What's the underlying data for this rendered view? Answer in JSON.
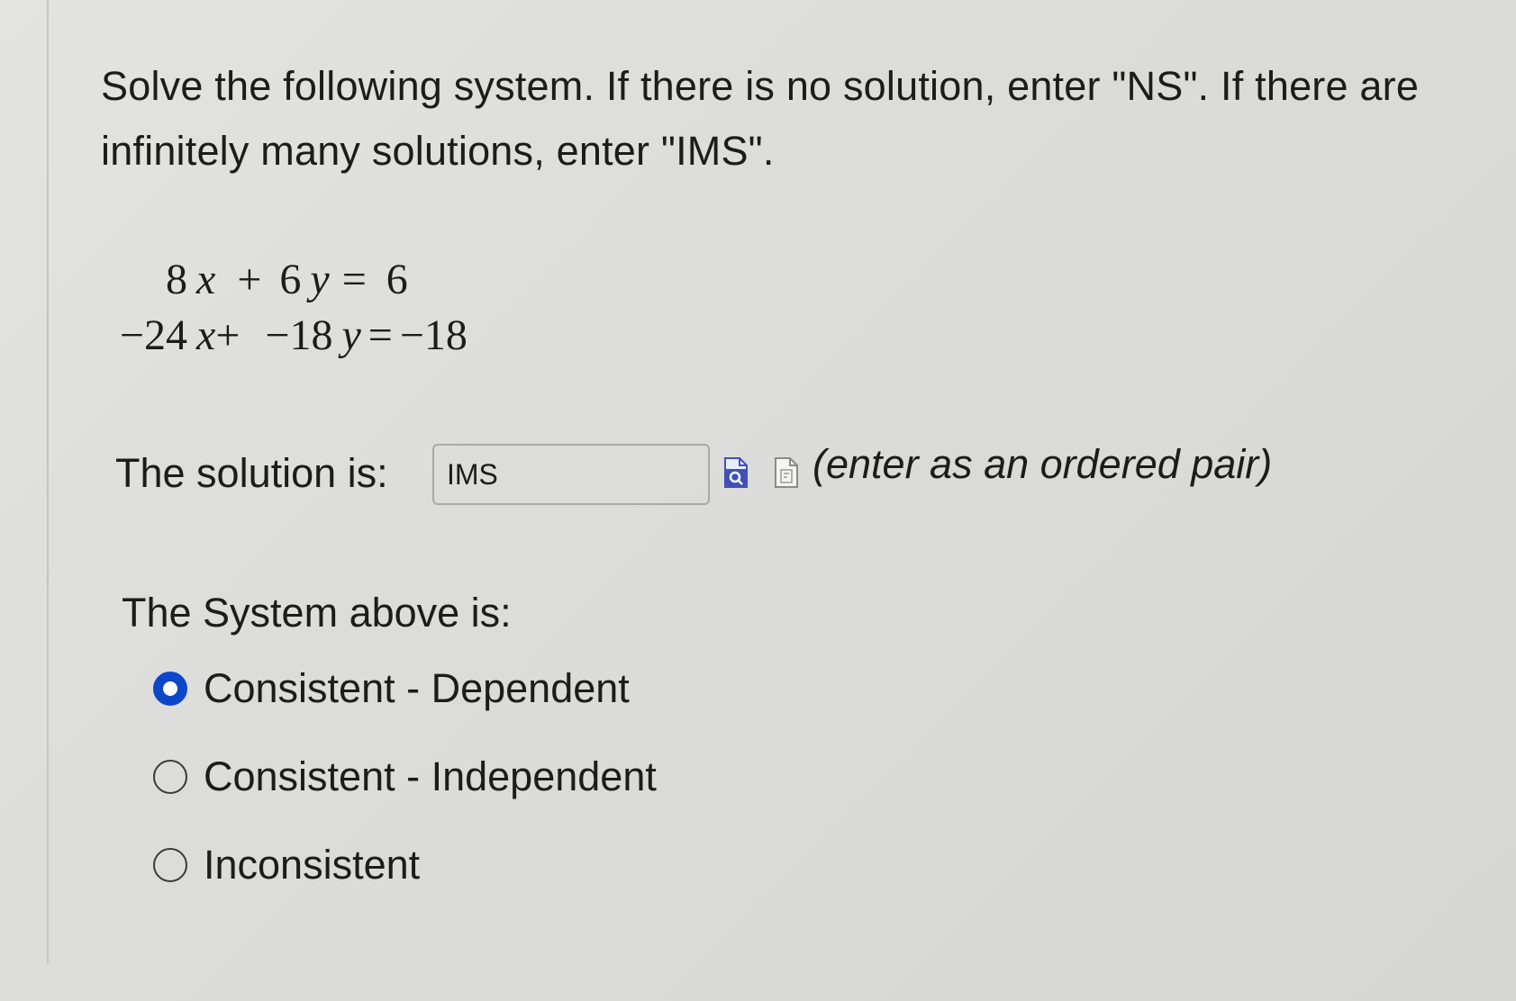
{
  "question": {
    "text": "Solve the following system. If there is no solution, enter \"NS\". If there are infinitely many solutions, enter \"IMS\"."
  },
  "system": {
    "eq1": {
      "a": "8",
      "x": "x",
      "plus": "+",
      "b": "6",
      "y": "y",
      "eq": "=",
      "c": "6"
    },
    "eq2": {
      "a": "−24",
      "x": "x",
      "plus": "+",
      "b": "−18",
      "y": "y",
      "eq": "=",
      "c": "−18"
    }
  },
  "solution": {
    "label": "The solution is:",
    "value": "IMS",
    "hint": "(enter as an ordered pair)"
  },
  "classification": {
    "label": "The System above is:",
    "options": [
      {
        "label": "Consistent - Dependent",
        "selected": true
      },
      {
        "label": "Consistent - Independent",
        "selected": false
      },
      {
        "label": "Inconsistent",
        "selected": false
      }
    ]
  },
  "colors": {
    "accent": "#0d47c9",
    "icon_blue": "#3f51b5"
  },
  "icons": {
    "preview": "preview-icon",
    "pdf": "pdf-icon"
  }
}
